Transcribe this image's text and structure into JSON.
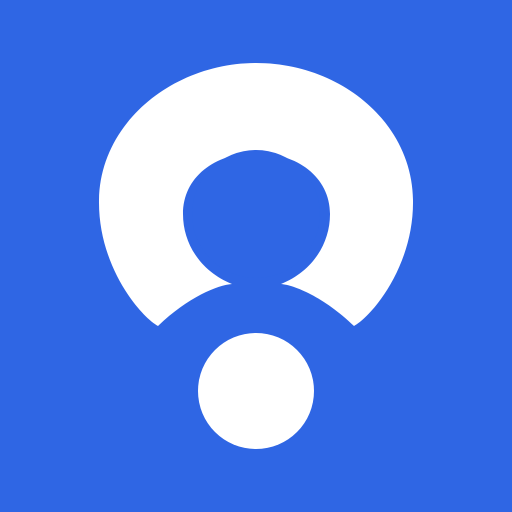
{
  "app": {
    "icon_name": "user-profile-logo-icon"
  },
  "colors": {
    "background": "#2f66e4",
    "foreground": "#ffffff"
  }
}
